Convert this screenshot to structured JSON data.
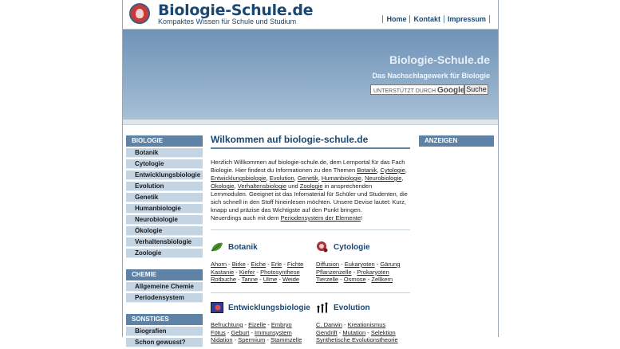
{
  "header": {
    "logo_title": "Biologie-Schule.de",
    "logo_subtitle": "Kompaktes Wissen für Schule und Studium",
    "topnav": [
      "Home",
      "Kontakt",
      "Impressum"
    ]
  },
  "banner": {
    "title": "Biologie-Schule.de",
    "subtitle": "Das Nachschlagewerk für Biologie",
    "search_placeholder_prefix": "UNTERSTÜTZT DURCH",
    "search_brand": "Google",
    "search_button": "Suche"
  },
  "sidebar": {
    "biologie_head": "BIOLOGIE",
    "biologie_items": [
      "Botanik",
      "Cytologie",
      "Entwicklungsbiologie",
      "Evolution",
      "Genetik",
      "Humanbiologie",
      "Neurobiologie",
      "Ökologie",
      "Verhaltensbiologie",
      "Zoologie"
    ],
    "chemie_head": "CHEMIE",
    "chemie_items": [
      "Allgemeine Chemie",
      "Periodensystem"
    ],
    "sonstiges_head": "SONSTIGES",
    "sonstiges_items": [
      "Biografien",
      "Schon gewusst?"
    ]
  },
  "main": {
    "heading": "Wilkommen auf biologie-schule.de",
    "intro_1": "Herzlich Willkommen auf biologie-schule.de, dem Lernportal für das Fach Biologie. Hier findest du Informationen zu den Themen ",
    "intro_links": [
      "Botanik",
      "Cytologie",
      "Entwicklungsbiologie",
      "Evolution",
      "Genetik",
      "Humanbiologie",
      "Neurobiologie",
      "Ökologie",
      "Verhaltensbiologie",
      "Zoologie"
    ],
    "intro_2": " in ansprechenden Lernmodulen. Geeignet ist das Infomaterial für Schüler und Studenten, die sich schnell in den Stoff hineinlesen möchten. Unsere Devise lautet: Kurz, knapp und präzise das Wichtigste auf den Punkt bringen.",
    "intro_3": "Neuerdings auch mit dem ",
    "intro_3_link": "Periodensystem der Elemente",
    "intro_3_end": "!",
    "categories": [
      {
        "title": "Botanik",
        "icon": "leaf-icon",
        "lines": [
          [
            "Ahorn",
            "Birke",
            "Eiche",
            "Erle",
            "Fichte"
          ],
          [
            "Kastanie",
            "Kiefer",
            "Photosynthese"
          ],
          [
            "Rotbuche",
            "Tanne",
            "Ulme",
            "Weide"
          ]
        ]
      },
      {
        "title": "Cytologie",
        "icon": "cell-icon",
        "lines": [
          [
            "Diffusion",
            "Eukaryoten",
            "Gärung"
          ],
          [
            "Pflanzenzelle",
            "Prokaryoten"
          ],
          [
            "Tierzelle",
            "Osmose",
            "Zellkern"
          ]
        ]
      },
      {
        "title": "Entwicklungsbiologie",
        "icon": "embryo-icon",
        "lines": [
          [
            "Befruchtung",
            "Eizelle",
            "Embryo"
          ],
          [
            "Fötus",
            "Geburt",
            "Immunsystem"
          ],
          [
            "Nidation",
            "Spermium",
            "Stammzelle"
          ]
        ]
      },
      {
        "title": "Evolution",
        "icon": "evolution-icon",
        "lines": [
          [
            "C. Darwin",
            "Kreationismus"
          ],
          [
            "Gendrift",
            "Mutation",
            "Selektion"
          ],
          [
            "Synthetische Evolutionstheorie"
          ]
        ]
      }
    ]
  },
  "rightcol": {
    "head": "ANZEIGEN"
  },
  "colors": {
    "accent": "#5d82a6",
    "brand": "#1c4771",
    "nav_item": "#c5d4e3"
  }
}
